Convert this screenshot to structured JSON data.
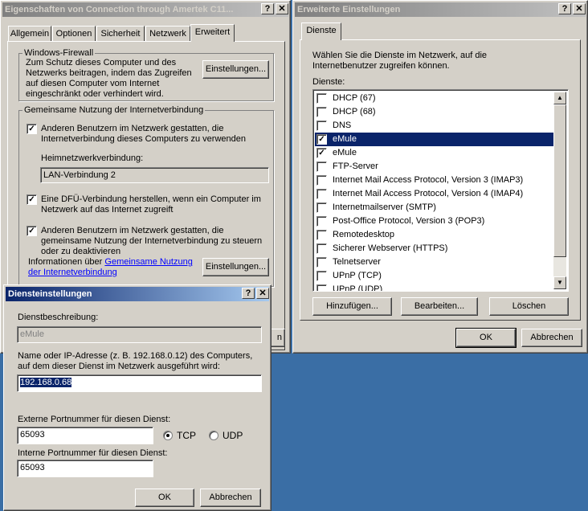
{
  "props": {
    "title": "Eigenschaften von Connection through Amertek C11...",
    "tabs": [
      "Allgemein",
      "Optionen",
      "Sicherheit",
      "Netzwerk",
      "Erweitert"
    ],
    "firewall": {
      "group_label": "Windows-Firewall",
      "text": "Zum Schutz dieses Computer und des Netzwerks beitragen, indem das Zugreifen auf diesen Computer vom Internet eingeschränkt oder verhindert wird.",
      "settings_button": "Einstellungen..."
    },
    "ics": {
      "group_label": "Gemeinsame Nutzung der Internetverbindung",
      "cb1": "Anderen Benutzern im Netzwerk gestatten, die Internetverbindung dieses Computers zu verwenden",
      "home_label": "Heimnetzwerkverbindung:",
      "home_value": "LAN-Verbindung 2",
      "cb2": "Eine DFÜ-Verbindung herstellen, wenn ein Computer im Netzwerk auf das Internet zugreift",
      "cb3": "Anderen Benutzern im Netzwerk gestatten, die gemeinsame Nutzung der Internetverbindung zu steuern oder zu deaktivieren",
      "info_prefix": "Informationen über ",
      "info_link": "Gemeinsame Nutzung der Internetverbindung",
      "settings_button": "Einstellungen...",
      "cb1_checked": true,
      "cb2_checked": true,
      "cb3_checked": true
    },
    "cancel_partial": "n"
  },
  "advanced": {
    "title": "Erweiterte Einstellungen",
    "tab": "Dienste",
    "intro": "Wählen Sie die Dienste im Netzwerk, auf die Internetbenutzer zugreifen können.",
    "services_label": "Dienste:",
    "services": [
      {
        "label": "DHCP (67)",
        "checked": false,
        "selected": false
      },
      {
        "label": "DHCP (68)",
        "checked": false,
        "selected": false
      },
      {
        "label": "DNS",
        "checked": false,
        "selected": false
      },
      {
        "label": "eMule",
        "checked": true,
        "selected": true
      },
      {
        "label": "eMule",
        "checked": true,
        "selected": false
      },
      {
        "label": "FTP-Server",
        "checked": false,
        "selected": false
      },
      {
        "label": "Internet Mail Access Protocol, Version 3 (IMAP3)",
        "checked": false,
        "selected": false
      },
      {
        "label": "Internet Mail Access Protocol, Version 4 (IMAP4)",
        "checked": false,
        "selected": false
      },
      {
        "label": "Internetmailserver (SMTP)",
        "checked": false,
        "selected": false
      },
      {
        "label": "Post-Office Protocol, Version 3 (POP3)",
        "checked": false,
        "selected": false
      },
      {
        "label": "Remotedesktop",
        "checked": false,
        "selected": false
      },
      {
        "label": "Sicherer Webserver (HTTPS)",
        "checked": false,
        "selected": false
      },
      {
        "label": "Telnetserver",
        "checked": false,
        "selected": false
      },
      {
        "label": "UPnP (TCP)",
        "checked": false,
        "selected": false
      },
      {
        "label": "UPnP (UDP)",
        "checked": false,
        "selected": false
      }
    ],
    "add_button": "Hinzufügen...",
    "edit_button": "Bearbeiten...",
    "delete_button": "Löschen",
    "ok_button": "OK",
    "cancel_button": "Abbrechen"
  },
  "service_settings": {
    "title": "Diensteinstellungen",
    "desc_label": "Dienstbeschreibung:",
    "desc_value": "eMule",
    "host_label": "Name oder IP-Adresse (z. B. 192.168.0.12) des Computers, auf dem dieser Dienst im Netzwerk ausgeführt wird:",
    "host_value": "192.168.0.68",
    "ext_port_label": "Externe Portnummer für diesen Dienst:",
    "ext_port_value": "65093",
    "tcp_label": "TCP",
    "udp_label": "UDP",
    "protocol_selected": "TCP",
    "int_port_label": "Interne Portnummer für diesen Dienst:",
    "int_port_value": "65093",
    "ok_button": "OK",
    "cancel_button": "Abbrechen"
  },
  "title_buttons": {
    "help": "?",
    "close": "✕"
  }
}
